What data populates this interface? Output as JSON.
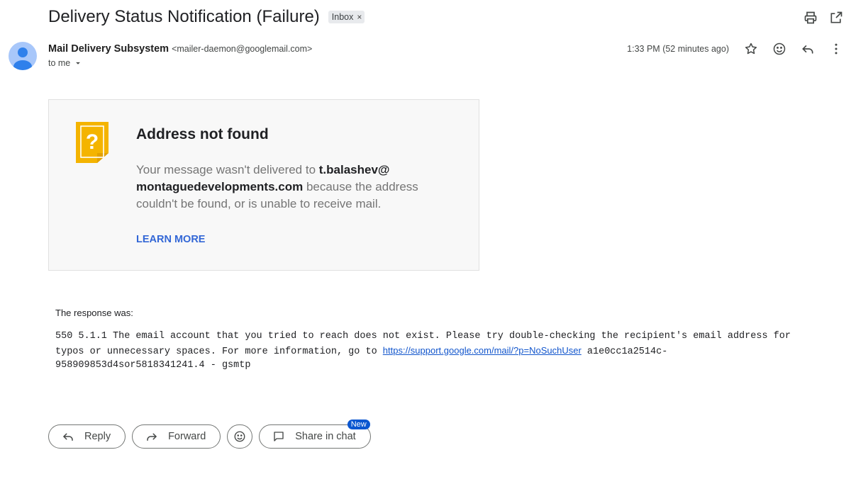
{
  "header": {
    "subject": "Delivery Status Notification (Failure)",
    "label": "Inbox",
    "label_remove": "×"
  },
  "sender": {
    "name": "Mail Delivery Subsystem",
    "email": "<mailer-daemon@googlemail.com>",
    "to": "to me",
    "time": "1:33 PM (52 minutes ago)"
  },
  "card": {
    "title": "Address not found",
    "msg_prefix": "Your message wasn't delivered to ",
    "recipient": "t.balashev@ montaguedevelopments.com",
    "msg_suffix": " because the address couldn't be found, or is unable to receive mail.",
    "learn_more": "LEARN MORE",
    "icon_glyph": "?",
    "accent": "#f4b400"
  },
  "response": {
    "label": "The response was:",
    "code_before": "550 5.1.1 The email account that you tried to reach does not exist. Please try double-checking the recipient's email address for typos or unnecessary spaces. For more information, go to ",
    "link": "https://support.google.com/mail/?p=NoSuchUser",
    "code_after": " a1e0cc1a2514c-958909853d4sor5818341241.4 - gsmtp"
  },
  "actions": {
    "reply": "Reply",
    "forward": "Forward",
    "share": "Share in chat",
    "new_badge": "New"
  }
}
